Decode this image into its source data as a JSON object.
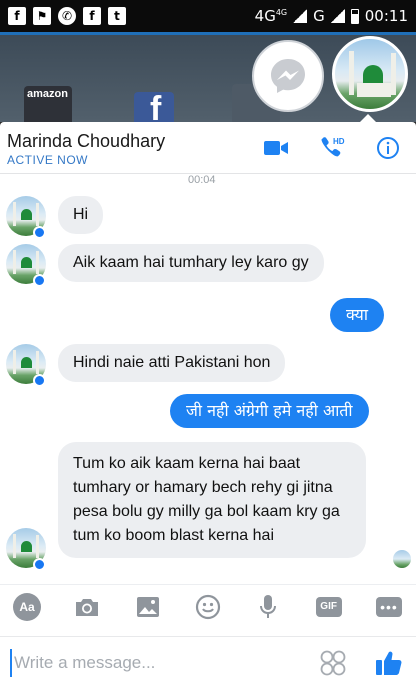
{
  "status_bar": {
    "network": "4G",
    "network_superscript": "4G",
    "network2": "G",
    "time": "00:11",
    "left_icons": [
      "facebook-icon",
      "facebook-pages-icon",
      "whatsapp-icon",
      "facebook-icon",
      "twitter-icon"
    ]
  },
  "background_apps": {
    "amazon": "amazon"
  },
  "header": {
    "contact_name": "Marinda Choudhary",
    "status": "ACTIVE NOW",
    "call_badge": "HD"
  },
  "timestamp": "00:04",
  "messages": [
    {
      "dir": "in",
      "text": "Hi"
    },
    {
      "dir": "in",
      "text": "Aik kaam hai tumhary ley karo gy"
    },
    {
      "dir": "out",
      "text": "क्या"
    },
    {
      "dir": "in",
      "text": "Hindi naie atti Pakistani hon"
    },
    {
      "dir": "out",
      "text": "जी नही अंग्रेगी हमे नही आती"
    },
    {
      "dir": "in",
      "text": "Tum ko aik kaam kerna hai baat tumhary or hamary bech rehy gi jitna pesa bolu gy milly ga bol kaam kry ga tum ko  boom blast kerna hai"
    }
  ],
  "toolbar": {
    "aa_label": "Aa",
    "gif_label": "GIF",
    "more_label": "•••"
  },
  "composer": {
    "placeholder": "Write a message..."
  },
  "colors": {
    "accent": "#1e82f2",
    "incoming_bubble": "#eceef1",
    "status_active": "#3478c6"
  }
}
